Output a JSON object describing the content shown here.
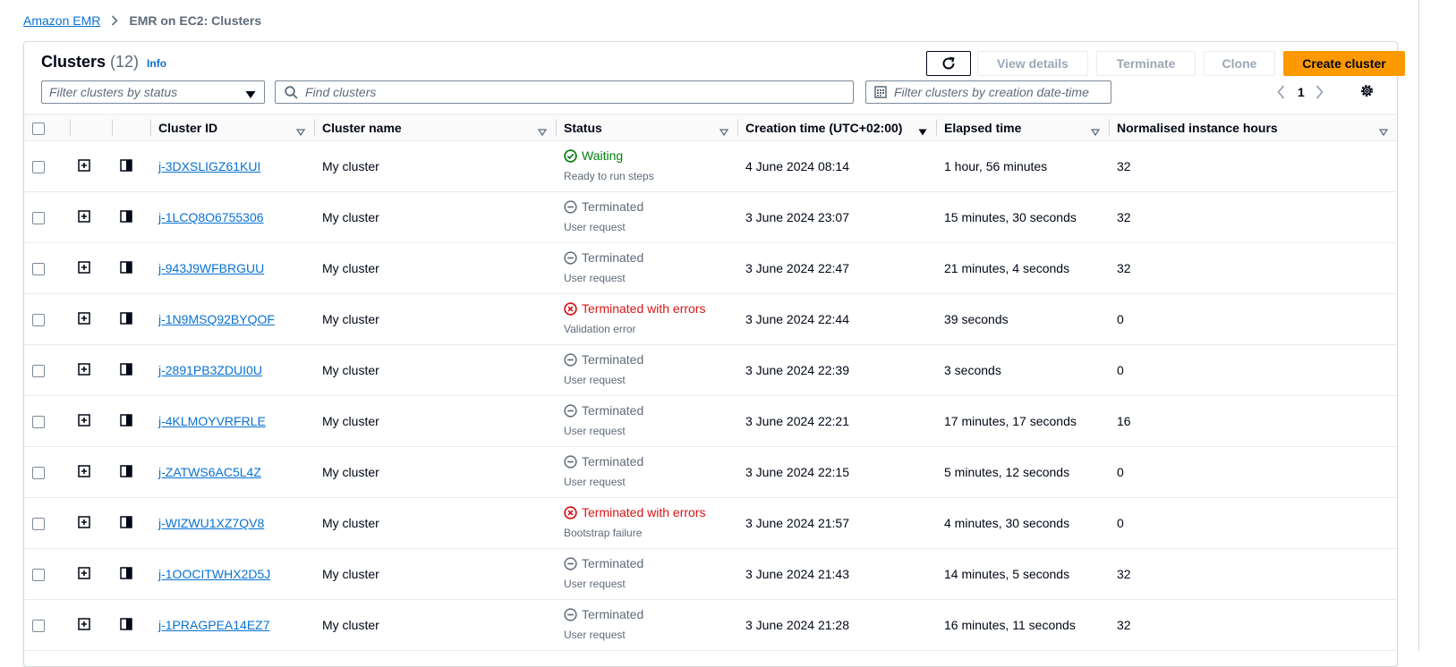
{
  "breadcrumb": {
    "root": "Amazon EMR",
    "current": "EMR on EC2: Clusters"
  },
  "header": {
    "title": "Clusters",
    "count": "(12)",
    "info": "Info"
  },
  "toolbar": {
    "view_details": "View details",
    "terminate": "Terminate",
    "clone": "Clone",
    "create_cluster": "Create cluster"
  },
  "filters": {
    "status_placeholder": "Filter clusters by status",
    "search_placeholder": "Find clusters",
    "date_placeholder": "Filter clusters by creation date-time"
  },
  "pagination": {
    "page": "1"
  },
  "columns": {
    "cluster_id": "Cluster ID",
    "cluster_name": "Cluster name",
    "status": "Status",
    "creation_time": "Creation time (UTC+02:00)",
    "elapsed_time": "Elapsed time",
    "instance_hours": "Normalised instance hours"
  },
  "colors": {
    "accent": "#0972d3",
    "primary": "#ff9900",
    "success": "#037f0c",
    "error": "#d91515",
    "muted": "#5f6b7a"
  },
  "rows": [
    {
      "id": "j-3DXSLIGZ61KUI",
      "name": "My cluster",
      "status": "Waiting",
      "status_kind": "waiting",
      "reason": "Ready to run steps",
      "created": "4 June 2024 08:14",
      "elapsed": "1 hour, 56 minutes",
      "hours": "32"
    },
    {
      "id": "j-1LCQ8O6755306",
      "name": "My cluster",
      "status": "Terminated",
      "status_kind": "terminated",
      "reason": "User request",
      "created": "3 June 2024 23:07",
      "elapsed": "15 minutes, 30 seconds",
      "hours": "32"
    },
    {
      "id": "j-943J9WFBRGUU",
      "name": "My cluster",
      "status": "Terminated",
      "status_kind": "terminated",
      "reason": "User request",
      "created": "3 June 2024 22:47",
      "elapsed": "21 minutes, 4 seconds",
      "hours": "32"
    },
    {
      "id": "j-1N9MSQ92BYQOF",
      "name": "My cluster",
      "status": "Terminated with errors",
      "status_kind": "errors",
      "reason": "Validation error",
      "created": "3 June 2024 22:44",
      "elapsed": "39 seconds",
      "hours": "0"
    },
    {
      "id": "j-2891PB3ZDUI0U",
      "name": "My cluster",
      "status": "Terminated",
      "status_kind": "terminated",
      "reason": "User request",
      "created": "3 June 2024 22:39",
      "elapsed": "3 seconds",
      "hours": "0"
    },
    {
      "id": "j-4KLMOYVRFRLE",
      "name": "My cluster",
      "status": "Terminated",
      "status_kind": "terminated",
      "reason": "User request",
      "created": "3 June 2024 22:21",
      "elapsed": "17 minutes, 17 seconds",
      "hours": "16"
    },
    {
      "id": "j-ZATWS6AC5L4Z",
      "name": "My cluster",
      "status": "Terminated",
      "status_kind": "terminated",
      "reason": "User request",
      "created": "3 June 2024 22:15",
      "elapsed": "5 minutes, 12 seconds",
      "hours": "0"
    },
    {
      "id": "j-WIZWU1XZ7QV8",
      "name": "My cluster",
      "status": "Terminated with errors",
      "status_kind": "errors",
      "reason": "Bootstrap failure",
      "created": "3 June 2024 21:57",
      "elapsed": "4 minutes, 30 seconds",
      "hours": "0"
    },
    {
      "id": "j-1OOCITWHX2D5J",
      "name": "My cluster",
      "status": "Terminated",
      "status_kind": "terminated",
      "reason": "User request",
      "created": "3 June 2024 21:43",
      "elapsed": "14 minutes, 5 seconds",
      "hours": "32"
    },
    {
      "id": "j-1PRAGPEA14EZ7",
      "name": "My cluster",
      "status": "Terminated",
      "status_kind": "terminated",
      "reason": "User request",
      "created": "3 June 2024 21:28",
      "elapsed": "16 minutes, 11 seconds",
      "hours": "32"
    }
  ]
}
